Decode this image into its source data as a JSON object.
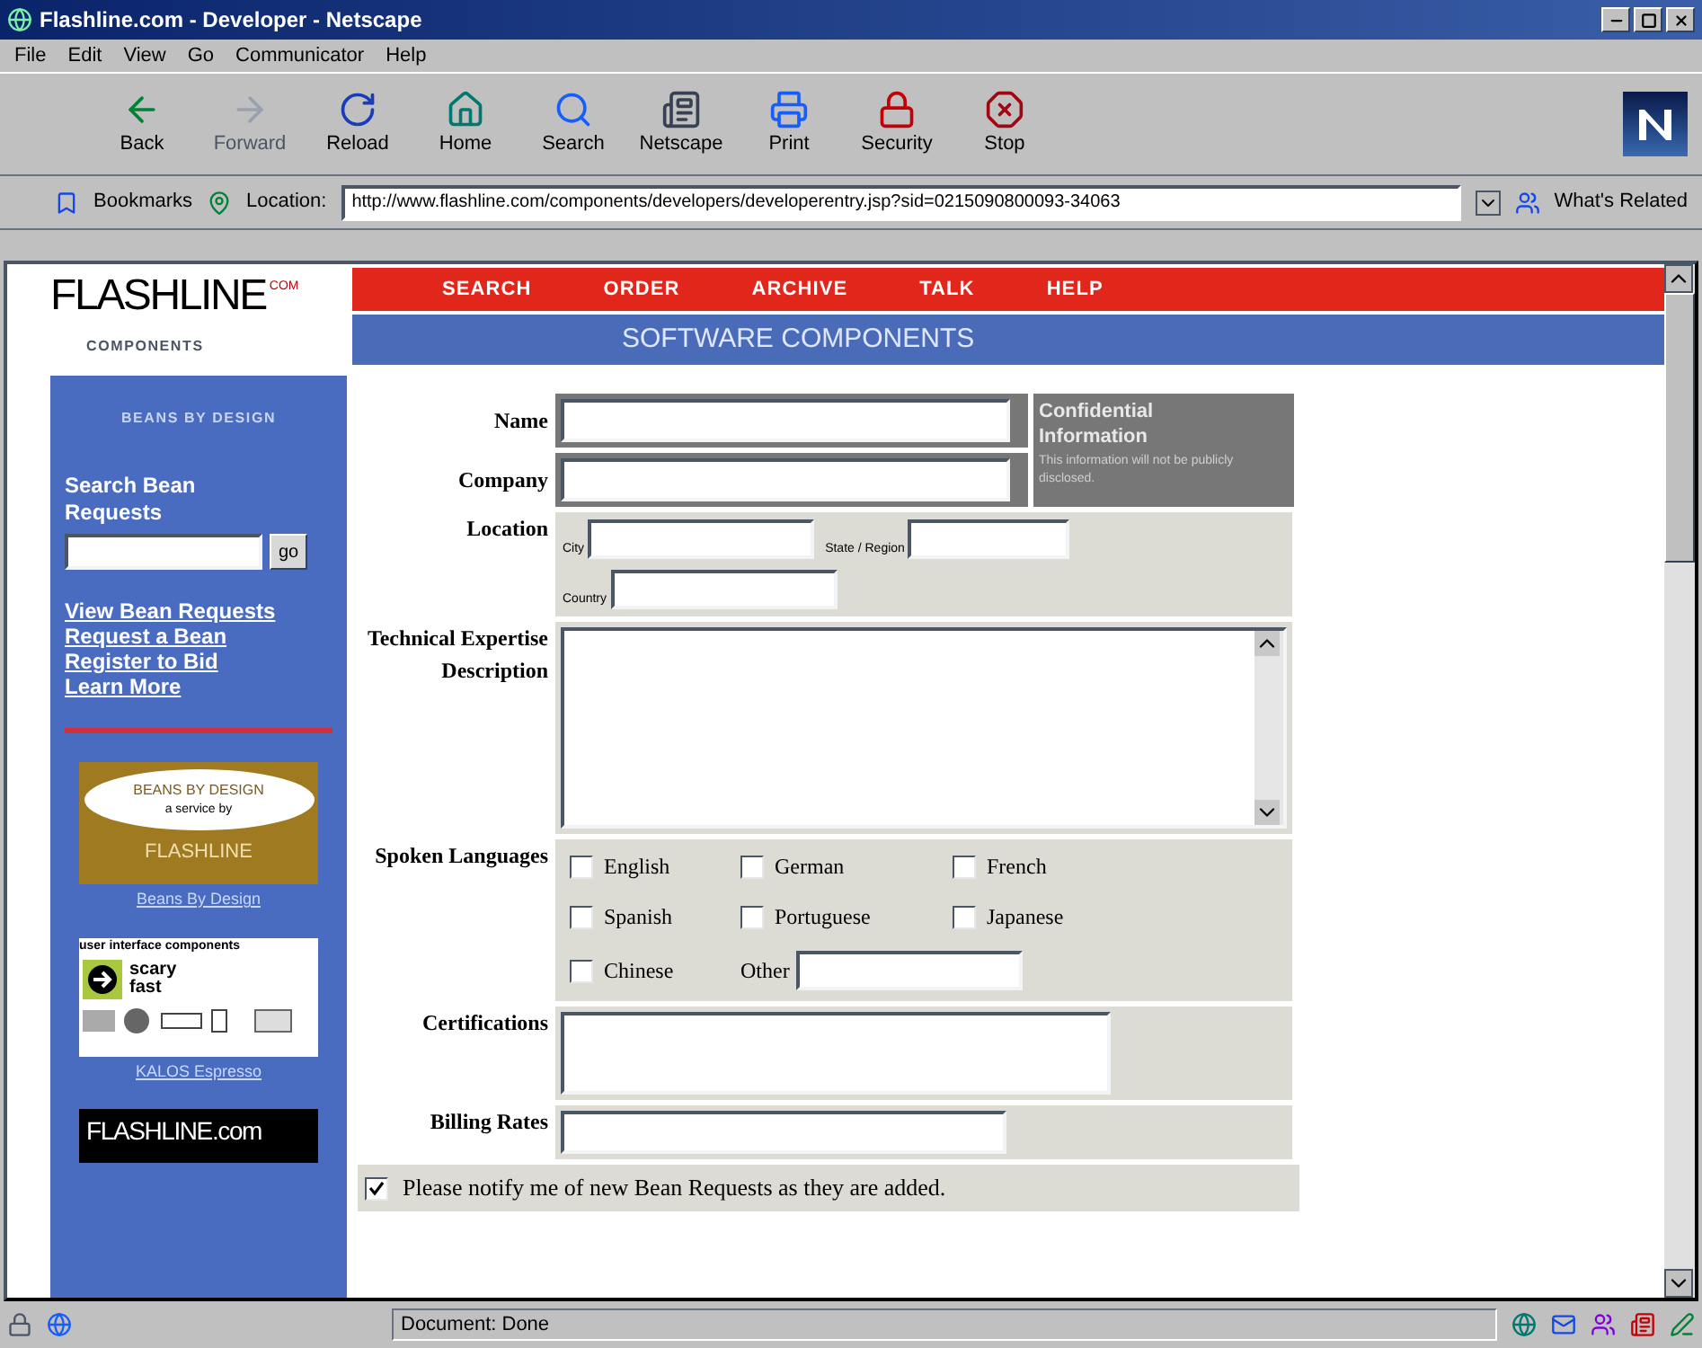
{
  "window": {
    "title": "Flashline.com - Developer - Netscape"
  },
  "menu": [
    "File",
    "Edit",
    "View",
    "Go",
    "Communicator",
    "Help"
  ],
  "toolbar": [
    {
      "label": "Back",
      "disabled": false
    },
    {
      "label": "Forward",
      "disabled": true
    },
    {
      "label": "Reload",
      "disabled": false
    },
    {
      "label": "Home",
      "disabled": false
    },
    {
      "label": "Search",
      "disabled": false
    },
    {
      "label": "Netscape",
      "disabled": false
    },
    {
      "label": "Print",
      "disabled": false
    },
    {
      "label": "Security",
      "disabled": false
    },
    {
      "label": "Stop",
      "disabled": false
    }
  ],
  "location_bar": {
    "bookmarks": "Bookmarks",
    "label": "Location:",
    "url": "http://www.flashline.com/components/developers/developerentry.jsp?sid=0215090800093-34063",
    "related": "What's Related"
  },
  "page": {
    "logo": {
      "name": "FLASHLINE",
      "suffix": "COM",
      "sub": "COMPONENTS"
    },
    "nav": [
      "SEARCH",
      "ORDER",
      "ARCHIVE",
      "TALK",
      "HELP"
    ],
    "banner": "SOFTWARE COMPONENTS",
    "sidebar": {
      "heading": "BEANS BY DESIGN",
      "search_label": "Search Bean Requests",
      "go": "go",
      "links": [
        "View Bean Requests",
        "Request a Bean",
        "Register to Bid",
        "Learn More"
      ],
      "ads": [
        {
          "lines": [
            "BEANS BY DESIGN",
            "a service by",
            "FLASHLINE"
          ],
          "link": "Beans By Design"
        },
        {
          "lines": [
            "user interface components",
            "scary fast"
          ],
          "link": "KALOS Espresso"
        },
        {
          "lines": [
            "FLASHLINE.com"
          ]
        }
      ]
    },
    "form": {
      "name_label": "Name",
      "company_label": "Company",
      "confidential": {
        "title": "Confidential Information",
        "note": "This information will not be publicly disclosed."
      },
      "location_label": "Location",
      "city": "City",
      "state": "State / Region",
      "country": "Country",
      "technical_label": "Technical Expertise Description",
      "languages_label": "Spoken Languages",
      "languages": [
        {
          "label": "English",
          "checked": false
        },
        {
          "label": "German",
          "checked": false
        },
        {
          "label": "French",
          "checked": false
        },
        {
          "label": "Spanish",
          "checked": false
        },
        {
          "label": "Portuguese",
          "checked": false
        },
        {
          "label": "Japanese",
          "checked": false
        },
        {
          "label": "Chinese",
          "checked": false
        }
      ],
      "other": "Other",
      "certifications_label": "Certifications",
      "billing_label": "Billing Rates",
      "notify": {
        "label": "Please notify me of new Bean Requests as they are added.",
        "checked": true
      }
    }
  },
  "status_bar": {
    "text": "Document: Done"
  }
}
